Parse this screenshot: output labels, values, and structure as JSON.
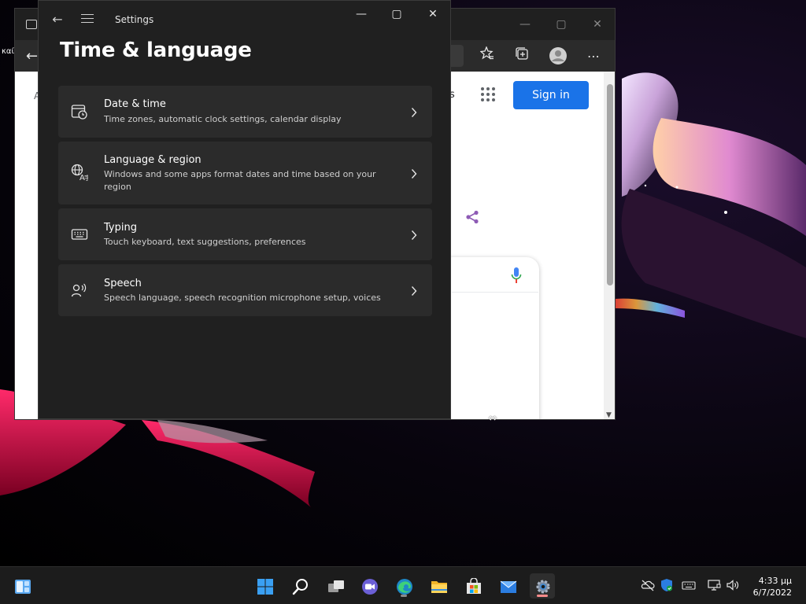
{
  "desktop": {
    "edge_text": "καί"
  },
  "browser": {
    "sign_in_label": "Sign in",
    "partial_text_s": "s",
    "partial_text_a": "A"
  },
  "settings": {
    "app_title": "Settings",
    "page_heading": "Time & language",
    "items": [
      {
        "title": "Date & time",
        "description": "Time zones, automatic clock settings, calendar display",
        "icon": "calendar-clock-icon"
      },
      {
        "title": "Language & region",
        "description": "Windows and some apps format dates and time based on your region",
        "icon": "globe-language-icon"
      },
      {
        "title": "Typing",
        "description": "Touch keyboard, text suggestions, preferences",
        "icon": "keyboard-icon"
      },
      {
        "title": "Speech",
        "description": "Speech language, speech recognition microphone setup, voices",
        "icon": "speech-icon"
      }
    ]
  },
  "taskbar": {
    "apps": [
      "widgets",
      "start",
      "search",
      "task-view",
      "chat",
      "edge",
      "file-explorer",
      "store",
      "mail",
      "settings"
    ],
    "active_app": "settings",
    "clock": {
      "time": "4:33 μμ",
      "date": "6/7/2022"
    }
  },
  "colors": {
    "settings_bg": "#202020",
    "card_bg": "#2b2b2b",
    "sign_in_blue": "#1a73e8",
    "taskbar_bg": "#1c1c1c"
  }
}
